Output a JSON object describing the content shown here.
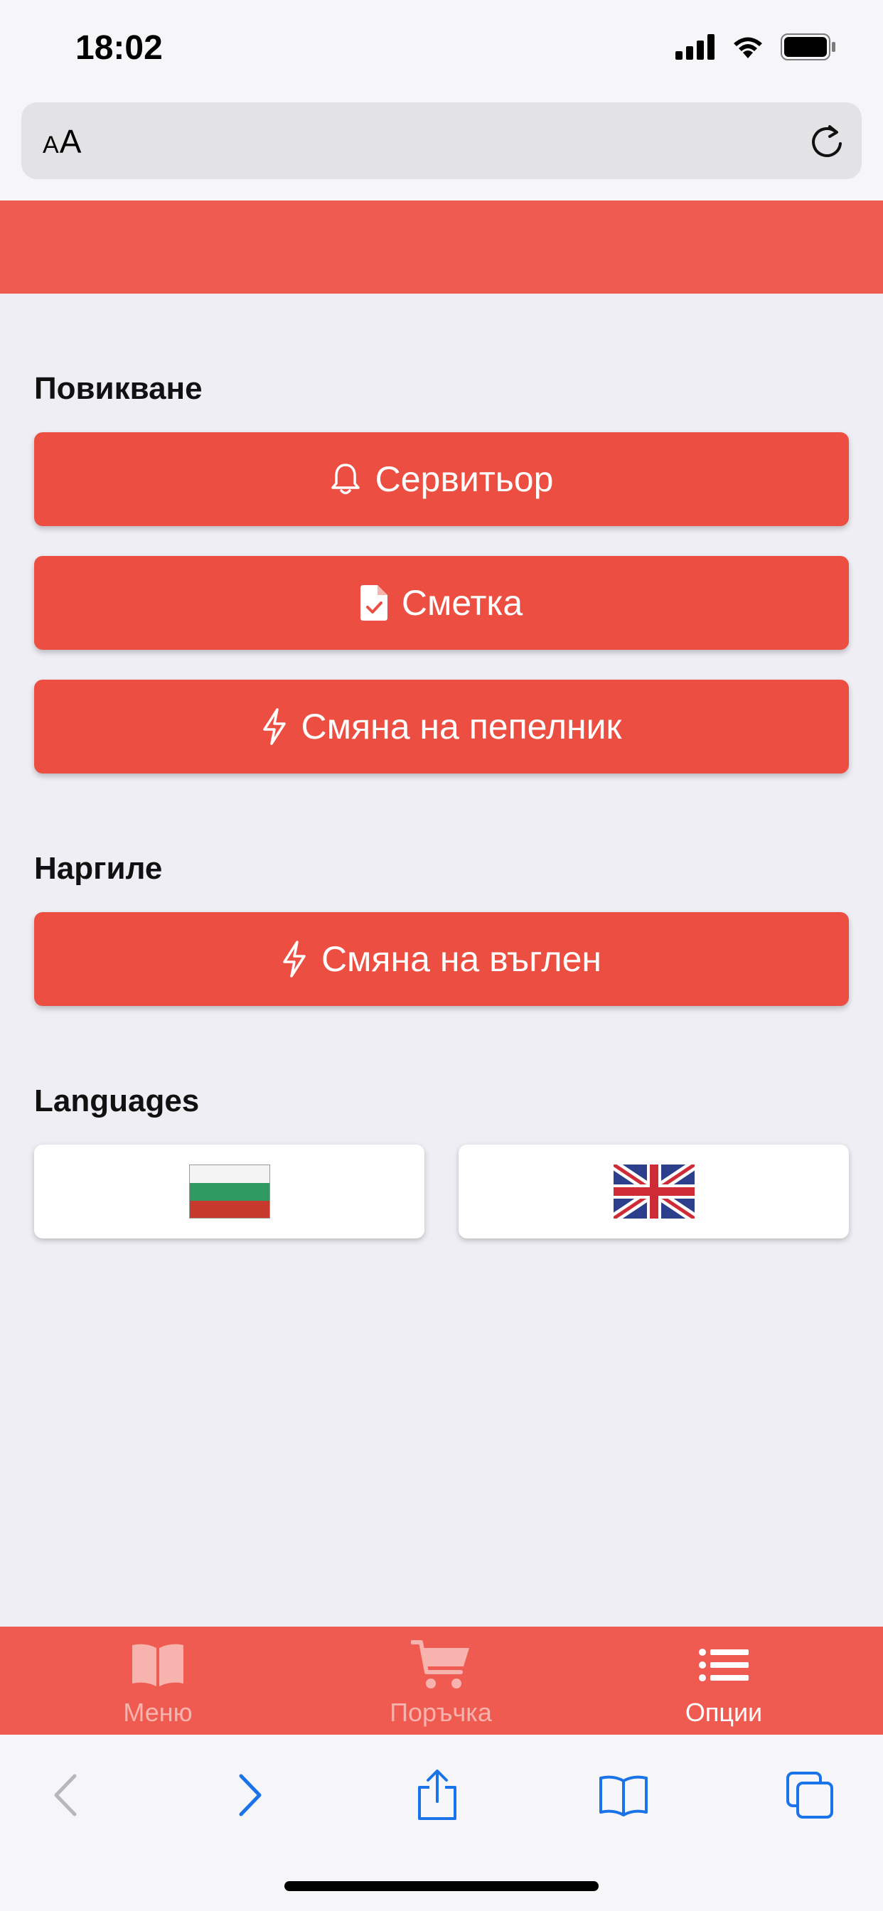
{
  "status_bar": {
    "time": "18:02"
  },
  "url_bar": {
    "aa_small": "A",
    "aa_large": "A"
  },
  "sections": {
    "call_title": "Повикване",
    "hookah_title": "Наргиле",
    "languages_title": "Languages"
  },
  "buttons": {
    "waiter": "Сервитьор",
    "bill": "Сметка",
    "ashtray": "Смяна на пепелник",
    "coal": "Смяна на въглен"
  },
  "tabs": [
    {
      "label": "Меню",
      "icon": "book-open-icon"
    },
    {
      "label": "Поръчка",
      "icon": "cart-icon"
    },
    {
      "label": "Опции",
      "icon": "list-icon"
    }
  ],
  "colors": {
    "accent": "#ec4f41",
    "header": "#ef5b50",
    "background": "#efeef4",
    "safari_blue": "#1a73e8"
  }
}
